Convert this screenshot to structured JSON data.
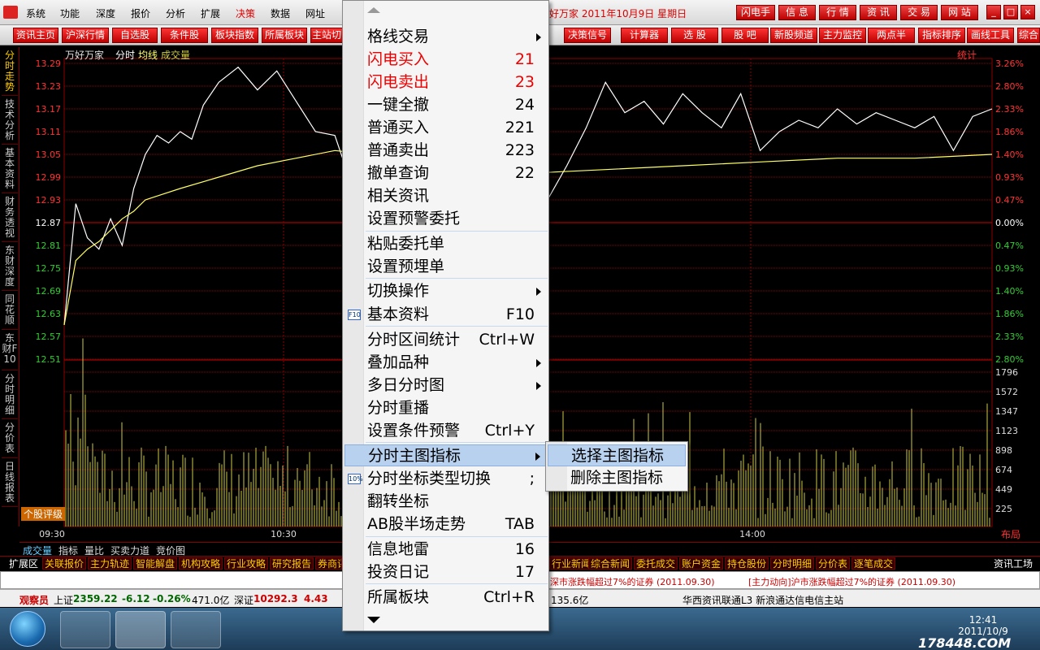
{
  "menubar": {
    "items": [
      "系统",
      "功能",
      "深度",
      "报价",
      "分析",
      "扩展",
      "决策",
      "数据",
      "网址"
    ],
    "active_index": 6,
    "title": "好万家 2011年10月9日 星期日",
    "right_buttons": [
      "闪电手",
      "信 息",
      "行 情",
      "资 讯",
      "交 易",
      "网 站"
    ],
    "window_controls": [
      "_",
      "□",
      "×"
    ]
  },
  "toolbar": {
    "left_buttons": [
      "资讯主页",
      "沪深行情",
      "自选股",
      "条件股",
      "板块指数",
      "所属板块",
      "主站切"
    ],
    "right_buttons": [
      "决策信号",
      "计算器",
      "选 股",
      "股 吧",
      "新股频道",
      "主力监控",
      "两点半",
      "指标排序",
      "画线工具",
      "综合"
    ]
  },
  "vertical_tabs": [
    "分时走势",
    "技术分析",
    "基本资料",
    "财务透视",
    "东财深度",
    "同花顺",
    "东财F10",
    "分时明细",
    "分价表",
    "日线报表"
  ],
  "chart": {
    "stock_name": "万好万家",
    "mode_label": "分时",
    "avg_label": "均线",
    "vol_label": "成交量",
    "stat_label": "统计",
    "rating_label": "个股评级",
    "layout_label": "布局"
  },
  "chart_data": {
    "type": "line",
    "price_ticks": [
      "13.29",
      "13.23",
      "13.17",
      "13.11",
      "13.05",
      "12.99",
      "12.93",
      "12.87",
      "12.81",
      "12.75",
      "12.69",
      "12.63",
      "12.57",
      "12.51"
    ],
    "pct_ticks": [
      "3.26%",
      "2.80%",
      "2.33%",
      "1.86%",
      "1.40%",
      "0.93%",
      "0.47%",
      "0.00%",
      "0.47%",
      "0.93%",
      "1.40%",
      "1.86%",
      "2.33%",
      "2.80%"
    ],
    "volume_ticks": [
      "1796",
      "1572",
      "1347",
      "1123",
      "898",
      "674",
      "449",
      "225"
    ],
    "time_ticks": [
      "09:30",
      "10:30",
      "14:00"
    ],
    "ylim": [
      12.45,
      13.29
    ],
    "series": [
      {
        "name": "分时",
        "x": [
          0,
          3,
          6,
          9,
          12,
          15,
          18,
          21,
          24,
          27,
          30,
          33,
          36,
          40,
          45,
          50,
          55,
          60,
          65,
          70,
          75,
          80,
          85,
          90,
          95,
          100,
          105,
          110,
          115,
          120,
          125,
          130,
          135,
          140,
          145,
          150,
          155,
          160,
          165,
          170,
          175,
          180,
          185,
          190,
          195,
          200,
          205,
          210,
          215,
          220,
          225,
          230,
          235,
          240
        ],
        "y": [
          12.6,
          12.92,
          12.83,
          12.8,
          12.88,
          12.81,
          12.96,
          13.05,
          13.1,
          13.08,
          13.11,
          13.09,
          13.18,
          13.24,
          13.28,
          13.22,
          13.27,
          13.19,
          13.11,
          13.1,
          12.95,
          12.97,
          12.94,
          12.92,
          12.95,
          12.89,
          12.92,
          12.95,
          12.9,
          12.84,
          12.93,
          13.02,
          13.12,
          13.24,
          13.16,
          13.19,
          13.13,
          13.21,
          13.16,
          13.12,
          13.21,
          13.06,
          13.11,
          13.14,
          13.12,
          13.17,
          13.13,
          13.16,
          13.14,
          13.12,
          13.15,
          13.06,
          13.15,
          13.17
        ]
      },
      {
        "name": "均线",
        "x": [
          0,
          3,
          6,
          9,
          12,
          15,
          18,
          21,
          24,
          30,
          40,
          50,
          60,
          70,
          80,
          90,
          100,
          120,
          140,
          160,
          180,
          200,
          220,
          240
        ],
        "y": [
          12.6,
          12.77,
          12.8,
          12.82,
          12.85,
          12.88,
          12.9,
          12.93,
          12.94,
          12.96,
          12.99,
          13.02,
          13.04,
          13.06,
          13.05,
          13.04,
          13.02,
          13.0,
          13.01,
          13.02,
          13.03,
          13.04,
          13.04,
          13.05
        ]
      }
    ]
  },
  "context_menu": {
    "items": [
      {
        "label": "格线交易",
        "shortcut": "",
        "submenu": true
      },
      {
        "label": "闪电买入",
        "shortcut": "21",
        "red": true
      },
      {
        "label": "闪电卖出",
        "shortcut": "23",
        "red": true
      },
      {
        "label": "一键全撤",
        "shortcut": "24"
      },
      {
        "label": "普通买入",
        "shortcut": "221"
      },
      {
        "label": "普通卖出",
        "shortcut": "223"
      },
      {
        "label": "撤单查询",
        "shortcut": "22"
      },
      {
        "label": "相关资讯",
        "shortcut": ""
      },
      {
        "label": "设置预警委托",
        "shortcut": ""
      },
      {
        "label": "粘贴委托单",
        "shortcut": ""
      },
      {
        "label": "设置预埋单",
        "shortcut": ""
      },
      {
        "label": "切换操作",
        "shortcut": "",
        "submenu": true
      },
      {
        "label": "基本资料",
        "shortcut": "F10",
        "icon": "F10"
      },
      {
        "label": "分时区间统计",
        "shortcut": "Ctrl+W"
      },
      {
        "label": "叠加品种",
        "shortcut": "",
        "submenu": true
      },
      {
        "label": "多日分时图",
        "shortcut": "",
        "submenu": true
      },
      {
        "label": "分时重播",
        "shortcut": ""
      },
      {
        "label": "设置条件预警",
        "shortcut": "Ctrl+Y"
      },
      {
        "label": "分时主图指标",
        "shortcut": "",
        "submenu": true,
        "highlight": true
      },
      {
        "label": "分时坐标类型切换",
        "shortcut": ";",
        "icon": "10%"
      },
      {
        "label": "翻转坐标",
        "shortcut": ""
      },
      {
        "label": "AB股半场走势",
        "shortcut": "TAB"
      },
      {
        "label": "信息地雷",
        "shortcut": "16"
      },
      {
        "label": "投资日记",
        "shortcut": "17"
      },
      {
        "label": "所属板块",
        "shortcut": "Ctrl+R"
      }
    ]
  },
  "submenu": {
    "items": [
      "选择主图指标",
      "删除主图指标"
    ]
  },
  "indicator_tabs": [
    "成交量",
    "指标",
    "量比",
    "买卖力道",
    "竞价图"
  ],
  "ext_bar": {
    "left": [
      "扩展区",
      "关联报价",
      "主力轨迹",
      "智能解盘",
      "机构攻略",
      "行业攻略",
      "研究报告",
      "券商评"
    ],
    "right": [
      "行业新闻",
      "综合新闻",
      "委托成交",
      "账户资金",
      "持仓股份",
      "分时明细",
      "分价表",
      "逐笔成交"
    ],
    "far_right": "资讯工场"
  },
  "ticker": {
    "left_text": "深市涨跌幅超过7%的证券 (2011.09.30)",
    "right_text": "[主力动向]沪市涨跌幅超过7%的证券 (2011.09.30)"
  },
  "statusbar": {
    "user": "观察员",
    "sh_label": "上证",
    "sh_value": "2359.22",
    "sh_change": "-6.12",
    "sh_pct": "-0.26%",
    "sh_amount": "471.0亿",
    "sz_label": "深证",
    "sz_value": "10292.3",
    "sz_change": "4.43",
    "sz_amount": "135.6亿",
    "server": "华西资讯联通L3 新浪通达信电信主站"
  },
  "taskbar": {
    "time": "12:41",
    "date": "2011/10/9",
    "watermark": "178448.COM"
  },
  "colors": {
    "price_line": "#ffffff",
    "avg_line": "#ffff66",
    "grid": "#8b0000",
    "up": "#ff3333",
    "down": "#33cc33",
    "volume": "#cccc44"
  }
}
